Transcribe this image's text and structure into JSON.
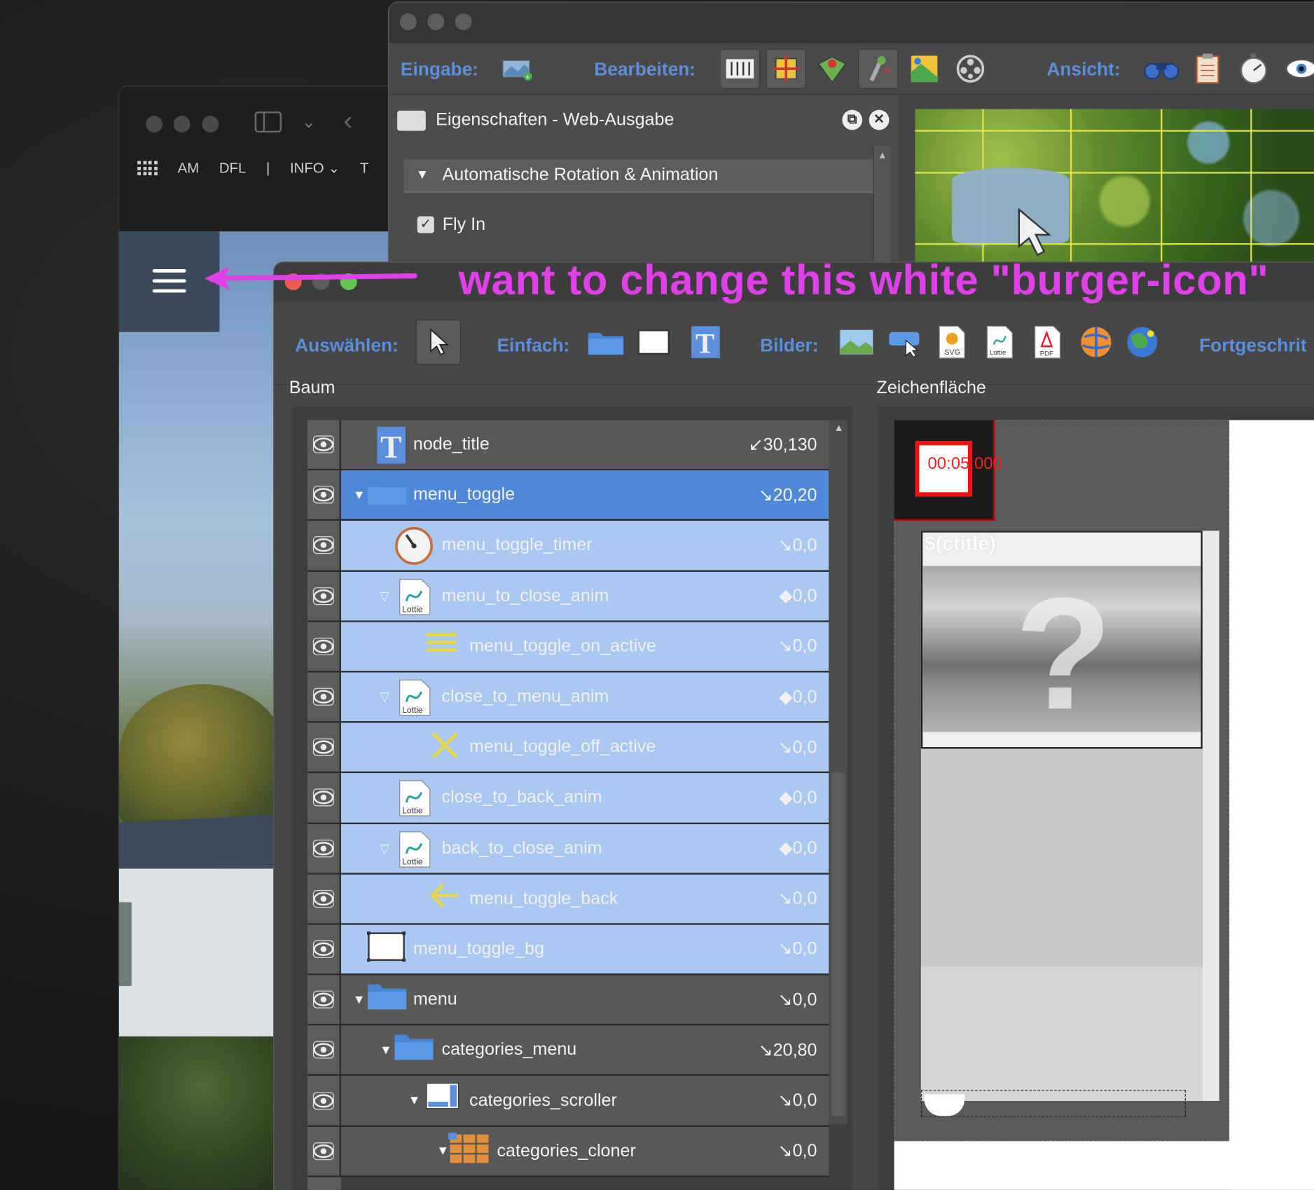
{
  "browser": {
    "nav_items": [
      "AM",
      "DFL",
      "|",
      "INFO",
      "T"
    ],
    "burger_icon": "hamburger-menu-icon"
  },
  "props_window": {
    "toolbar": {
      "eingabe_label": "Eingabe:",
      "bearbeiten_label": "Bearbeiten:",
      "ansicht_label": "Ansicht:"
    },
    "panel_title": "Eigenschaften - Web-Ausgabe",
    "section_title": "Automatische Rotation & Animation",
    "fly_in_label": "Fly In",
    "fly_in_checked": true,
    "check_glyph": "✓"
  },
  "main_window": {
    "toolbar": {
      "auswaehlen_label": "Auswählen:",
      "einfach_label": "Einfach:",
      "bilder_label": "Bilder:",
      "fortgeschritten_label": "Fortgeschrit",
      "svg_label": "SVG",
      "lottie_label": "Lottie",
      "pdf_label": "PDF"
    },
    "tree_title": "Baum",
    "canvas_title": "Zeichenfläche",
    "tree_rows": [
      {
        "name": "node_title",
        "pos": "↙30,130",
        "icon": "text-icon",
        "state": "normal",
        "twist": ""
      },
      {
        "name": "menu_toggle",
        "pos": "↘20,20",
        "icon": "folder-icon",
        "state": "selected",
        "twist": "▼"
      },
      {
        "name": "menu_toggle_timer",
        "pos": "↘0,0",
        "icon": "timer-icon",
        "state": "highlight",
        "twist": ""
      },
      {
        "name": "menu_to_close_anim",
        "pos": "◆0,0",
        "icon": "lottie-icon",
        "state": "highlight",
        "twist": "▽"
      },
      {
        "name": "menu_toggle_on_active",
        "pos": "↘0,0",
        "icon": "burger-lines-icon",
        "state": "highlight",
        "twist": ""
      },
      {
        "name": "close_to_menu_anim",
        "pos": "◆0,0",
        "icon": "lottie-icon",
        "state": "highlight",
        "twist": "▽"
      },
      {
        "name": "menu_toggle_off_active",
        "pos": "↘0,0",
        "icon": "x-close-icon",
        "state": "highlight",
        "twist": ""
      },
      {
        "name": "close_to_back_anim",
        "pos": "◆0,0",
        "icon": "lottie-icon",
        "state": "highlight",
        "twist": ""
      },
      {
        "name": "back_to_close_anim",
        "pos": "◆0,0",
        "icon": "lottie-icon",
        "state": "highlight",
        "twist": "▽"
      },
      {
        "name": "menu_toggle_back",
        "pos": "↘0,0",
        "icon": "arrow-left-icon",
        "state": "highlight",
        "twist": ""
      },
      {
        "name": "menu_toggle_bg",
        "pos": "↘0,0",
        "icon": "rectangle-icon",
        "state": "highlight",
        "twist": ""
      },
      {
        "name": "menu",
        "pos": "↘0,0",
        "icon": "folder-icon",
        "state": "normal",
        "twist": "▼"
      },
      {
        "name": "categories_menu",
        "pos": "↘20,80",
        "icon": "folder-icon",
        "state": "normal",
        "twist": "▼"
      },
      {
        "name": "categories_scroller",
        "pos": "↘0,0",
        "icon": "scroller-icon",
        "state": "normal",
        "twist": "▼"
      },
      {
        "name": "categories_cloner",
        "pos": "↘0,0",
        "icon": "cloner-grid-icon",
        "state": "normal",
        "twist": "▼"
      }
    ],
    "canvas": {
      "timer_text": "00:05:000",
      "card_title": "$(ctitle)",
      "question_mark": "?"
    }
  },
  "annotation": {
    "text": "want to change this white \"burger-icon\"",
    "color": "#e040e8"
  },
  "colors": {
    "accent_label": "#5b8fdc",
    "selected_row": "#4f88d9",
    "highlight_row": "#a9c8f2",
    "timer_red": "#f02020"
  }
}
